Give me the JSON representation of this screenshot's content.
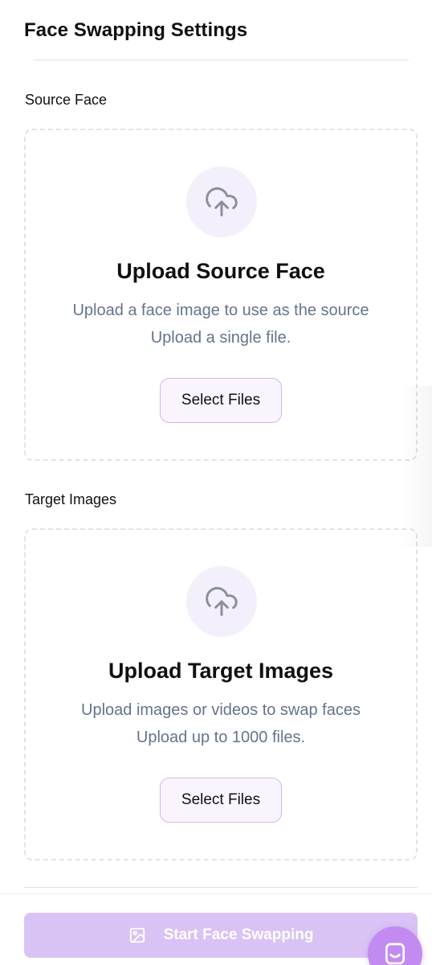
{
  "header": {
    "title": "Face Swapping Settings"
  },
  "source": {
    "label": "Source Face",
    "icon": "upload-cloud-icon",
    "heading": "Upload Source Face",
    "description": "Upload a face image to use as the source",
    "limit": "Upload a single file.",
    "button_label": "Select Files"
  },
  "target": {
    "label": "Target Images",
    "icon": "upload-cloud-icon",
    "heading": "Upload Target Images",
    "description": "Upload images or videos to swap faces",
    "limit": "Upload up to 1000 files.",
    "button_label": "Select Files"
  },
  "footer": {
    "start_label": "Start Face Swapping",
    "start_icon": "image-icon",
    "start_disabled": true,
    "chat_icon": "chat-icon"
  },
  "colors": {
    "accent": "#c38bf2",
    "start_button_disabled": "#d8c3f4",
    "icon_circle": "#f3effb",
    "muted_text": "#64748b",
    "dashed_border": "#dfe3ea",
    "select_button_border": "#d4b4ee"
  }
}
